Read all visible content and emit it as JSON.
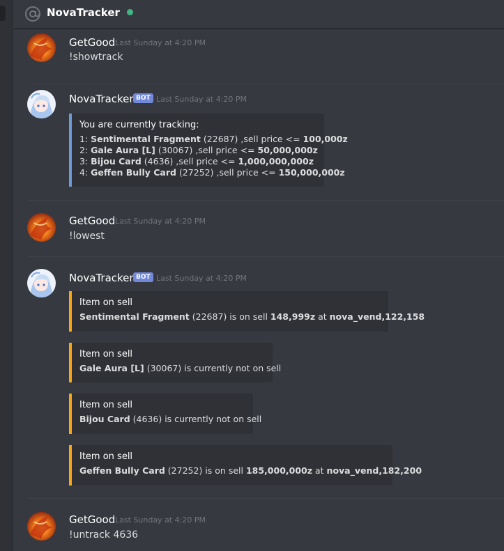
{
  "header": {
    "channel_name": "NovaTracker",
    "status_color": "#43b581"
  },
  "colors": {
    "bot_tag": "#7289da",
    "embed_tracking": "#6d9bd4",
    "embed_sell": "#faa61a"
  },
  "messages": [
    {
      "author": "GetGood",
      "time": "Last Sunday at 4:20 PM",
      "content": "!showtrack"
    },
    {
      "author": "NovaTracker",
      "bot_tag": "BOT",
      "time": "Last Sunday at 4:20 PM",
      "embed": {
        "title": "You are currently tracking:",
        "lines": [
          {
            "idx": "1:",
            "name": "Sentimental Fragment",
            "id": "(22687)",
            "mid": ",sell price <=",
            "price": "100,000z"
          },
          {
            "idx": "2:",
            "name": "Gale Aura [L]",
            "id": "(30067)",
            "mid": ",sell price <=",
            "price": "50,000,000z"
          },
          {
            "idx": "3:",
            "name": "Bijou Card",
            "id": "(4636)",
            "mid": ",sell price <=",
            "price": "1,000,000,000z"
          },
          {
            "idx": "4:",
            "name": "Geffen Bully Card",
            "id": "(27252)",
            "mid": ",sell price <=",
            "price": "150,000,000z"
          }
        ]
      }
    },
    {
      "author": "GetGood",
      "time": "Last Sunday at 4:20 PM",
      "content": "!lowest"
    },
    {
      "author": "NovaTracker",
      "bot_tag": "BOT",
      "time": "Last Sunday at 4:20 PM",
      "embeds": [
        {
          "title": "Item on sell",
          "name": "Sentimental Fragment",
          "id": "(22687)",
          "mid": "is on sell",
          "price": "148,999z",
          "at": "at",
          "vendor": "nova_vend,122,158"
        },
        {
          "title": "Item on sell",
          "name": "Gale Aura [L]",
          "id": "(30067)",
          "rest": "is currently not on sell"
        },
        {
          "title": "Item on sell",
          "name": "Bijou Card",
          "id": "(4636)",
          "rest": "is currently not on sell"
        },
        {
          "title": "Item on sell",
          "name": "Geffen Bully Card",
          "id": "(27252)",
          "mid": "is on sell",
          "price": "185,000,000z",
          "at": "at",
          "vendor": "nova_vend,182,200"
        }
      ]
    },
    {
      "author": "GetGood",
      "time": "Last Sunday at 4:20 PM",
      "content": "!untrack 4636"
    }
  ]
}
